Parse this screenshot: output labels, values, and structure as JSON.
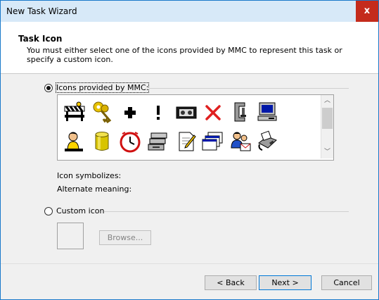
{
  "window": {
    "title": "New Task Wizard",
    "close_glyph": "x"
  },
  "header": {
    "title": "Task Icon",
    "description": "You must either select one of the icons provided by MMC to represent this task or specify a custom icon."
  },
  "options": {
    "mmc_label": "Icons provided by MMC:",
    "custom_label": "Custom icon"
  },
  "icons": [
    {
      "name": "construction-barrier-icon"
    },
    {
      "name": "keys-icon"
    },
    {
      "name": "plus-icon"
    },
    {
      "name": "exclamation-icon"
    },
    {
      "name": "tape-drive-icon"
    },
    {
      "name": "red-x-icon"
    },
    {
      "name": "clamp-icon"
    },
    {
      "name": "computer-icon"
    },
    {
      "name": "user-icon"
    },
    {
      "name": "database-cylinder-icon"
    },
    {
      "name": "clock-icon"
    },
    {
      "name": "server-stack-icon"
    },
    {
      "name": "notepad-edit-icon"
    },
    {
      "name": "windows-stack-icon"
    },
    {
      "name": "users-mail-icon"
    },
    {
      "name": "fax-icon"
    }
  ],
  "info": {
    "symbolizes_label": "Icon symbolizes:",
    "alternate_label": "Alternate meaning:"
  },
  "custom": {
    "browse_label": "Browse..."
  },
  "buttons": {
    "back": "< Back",
    "next": "Next >",
    "cancel": "Cancel"
  },
  "colors": {
    "accent": "#0078d7",
    "title_bg": "#d7e9f8",
    "close_bg": "#c42b1c"
  }
}
